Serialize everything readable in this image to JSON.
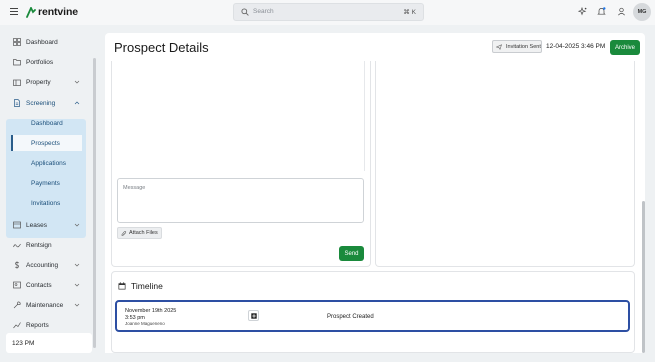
{
  "app": {
    "name": "rentvine"
  },
  "search": {
    "placeholder": "Search",
    "shortcut": "⌘ K"
  },
  "user": {
    "initials": "MG"
  },
  "sidebar": {
    "items": [
      {
        "label": "Dashboard",
        "icon": "dashboard-icon"
      },
      {
        "label": "Portfolios",
        "icon": "folder-icon"
      },
      {
        "label": "Property",
        "icon": "building-icon"
      },
      {
        "label": "Screening",
        "icon": "screening-icon"
      },
      {
        "label": "Leases",
        "icon": "lease-icon"
      },
      {
        "label": "Rentsign",
        "icon": "signature-icon"
      },
      {
        "label": "Accounting",
        "icon": "dollar-icon"
      },
      {
        "label": "Contacts",
        "icon": "contacts-icon"
      },
      {
        "label": "Maintenance",
        "icon": "wrench-icon"
      },
      {
        "label": "Reports",
        "icon": "chart-icon"
      }
    ],
    "screening_sub": [
      {
        "label": "Dashboard"
      },
      {
        "label": "Prospects"
      },
      {
        "label": "Applications"
      },
      {
        "label": "Payments"
      },
      {
        "label": "Invitations"
      }
    ],
    "active_sub": "Prospects",
    "time_card": "123 PM"
  },
  "header": {
    "title": "Prospect Details",
    "status_badge": "Invitation Sent",
    "status_date": "12-04-2025 3:46 PM",
    "archive_label": "Archive"
  },
  "message": {
    "placeholder": "Message",
    "attach_label": "Attach Files",
    "send_label": "Send"
  },
  "timeline": {
    "title": "Timeline",
    "entries": [
      {
        "date": "November 19th 2025",
        "time": "3:53 pm",
        "user": "Joanne Magueneno",
        "event": "Prospect Created"
      }
    ]
  },
  "colors": {
    "accent_green": "#1a8a3c",
    "sidebar_active_bg": "#d2e6f4",
    "timeline_border": "#2d4fa3"
  }
}
